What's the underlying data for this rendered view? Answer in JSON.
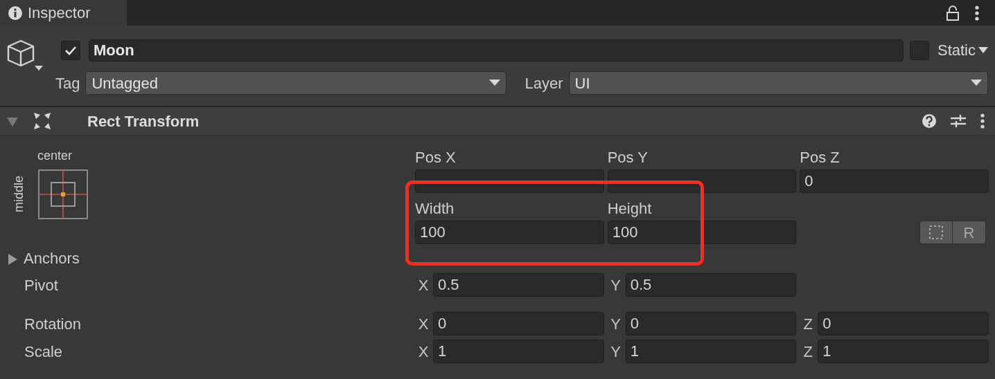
{
  "window": {
    "tab": "Inspector"
  },
  "object": {
    "active": true,
    "name": "Moon",
    "static": false,
    "static_label": "Static",
    "tag_label": "Tag",
    "tag": "Untagged",
    "layer_label": "Layer",
    "layer": "UI"
  },
  "component": {
    "title": "Rect Transform",
    "expanded": true
  },
  "anchor_preset": {
    "horizontal": "center",
    "vertical": "middle"
  },
  "rect_fields": [
    {
      "label": "Pos X"
    },
    {
      "label": "Pos Y"
    },
    {
      "label": "Pos Z",
      "value": "0"
    },
    {
      "label": "Width",
      "value": "100"
    },
    {
      "label": "Height",
      "value": "100"
    }
  ],
  "raw_edit_button": {
    "label": "R"
  },
  "anchors": {
    "label": "Anchors",
    "expanded": false
  },
  "vectors": [
    {
      "label": "Pivot",
      "kind": "vector2",
      "components": [
        {
          "axis": "X",
          "value": "0.5"
        },
        {
          "axis": "Y",
          "value": "0.5"
        }
      ]
    },
    {
      "label": "Rotation",
      "kind": "vector3",
      "components": [
        {
          "axis": "X",
          "value": "0"
        },
        {
          "axis": "Y",
          "value": "0"
        },
        {
          "axis": "Z",
          "value": "0"
        }
      ]
    },
    {
      "label": "Scale",
      "kind": "vector3",
      "components": [
        {
          "axis": "X",
          "value": "1"
        },
        {
          "axis": "Y",
          "value": "1"
        },
        {
          "axis": "Z",
          "value": "1"
        }
      ]
    }
  ]
}
